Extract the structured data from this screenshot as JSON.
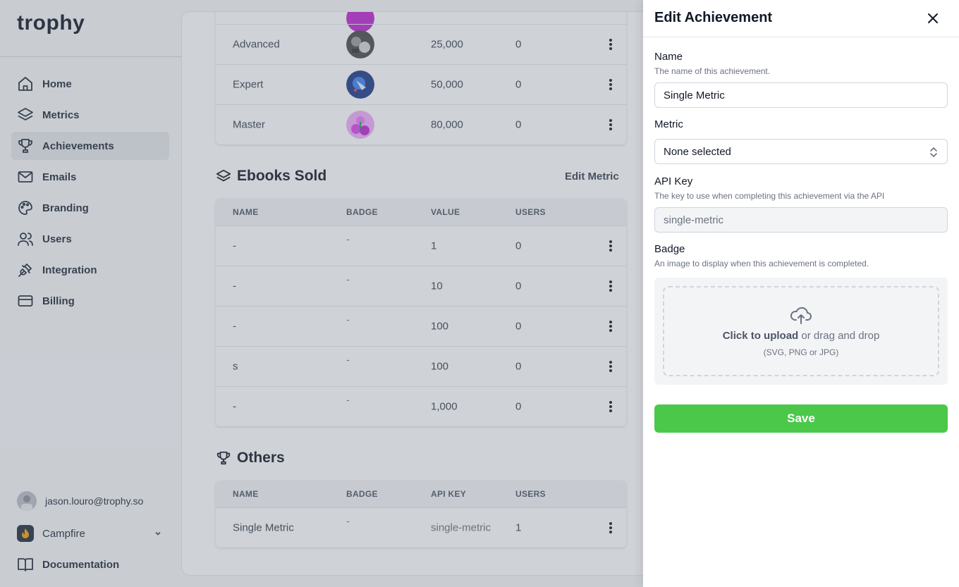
{
  "app": {
    "logo": "trophy"
  },
  "sidebar": {
    "items": [
      {
        "label": "Home",
        "icon": "home-icon"
      },
      {
        "label": "Metrics",
        "icon": "layers-icon"
      },
      {
        "label": "Achievements",
        "icon": "trophy-icon",
        "active": true
      },
      {
        "label": "Emails",
        "icon": "mail-icon"
      },
      {
        "label": "Branding",
        "icon": "palette-icon"
      },
      {
        "label": "Users",
        "icon": "users-icon"
      },
      {
        "label": "Integration",
        "icon": "plug-icon"
      },
      {
        "label": "Billing",
        "icon": "credit-card-icon"
      }
    ],
    "user_email": "jason.louro@trophy.so",
    "org_name": "Campfire",
    "documentation": "Documentation"
  },
  "top_table": {
    "rows": [
      {
        "name": "Advanced",
        "value": "25,000",
        "users": "0"
      },
      {
        "name": "Expert",
        "value": "50,000",
        "users": "0"
      },
      {
        "name": "Master",
        "value": "80,000",
        "users": "0"
      }
    ]
  },
  "ebooks": {
    "title": "Ebooks Sold",
    "edit_label": "Edit Metric",
    "headers": [
      "NAME",
      "BADGE",
      "VALUE",
      "USERS"
    ],
    "rows": [
      {
        "name": "-",
        "badge": "-",
        "value": "1",
        "users": "0"
      },
      {
        "name": "-",
        "badge": "-",
        "value": "10",
        "users": "0"
      },
      {
        "name": "-",
        "badge": "-",
        "value": "100",
        "users": "0"
      },
      {
        "name": "s",
        "badge": "-",
        "value": "100",
        "users": "0"
      },
      {
        "name": "-",
        "badge": "-",
        "value": "1,000",
        "users": "0"
      }
    ]
  },
  "others": {
    "title": "Others",
    "headers": [
      "NAME",
      "BADGE",
      "API KEY",
      "USERS"
    ],
    "rows": [
      {
        "name": "Single Metric",
        "badge": "-",
        "api_key": "single-metric",
        "users": "1"
      }
    ]
  },
  "drawer": {
    "title": "Edit Achievement",
    "name_label": "Name",
    "name_help": "The name of this achievement.",
    "name_value": "Single Metric",
    "metric_label": "Metric",
    "metric_value": "None selected",
    "api_label": "API Key",
    "api_help": "The key to use when completing this achievement via the API",
    "api_value": "single-metric",
    "badge_label": "Badge",
    "badge_help": "An image to display when this achievement is completed.",
    "upload_link": "Click to upload",
    "upload_text": " or drag and drop",
    "upload_hint": "(SVG, PNG or JPG)",
    "save_label": "Save"
  },
  "colors": {
    "accent": "#4bc84a",
    "overlay": "rgba(107,114,128,0.32)"
  }
}
